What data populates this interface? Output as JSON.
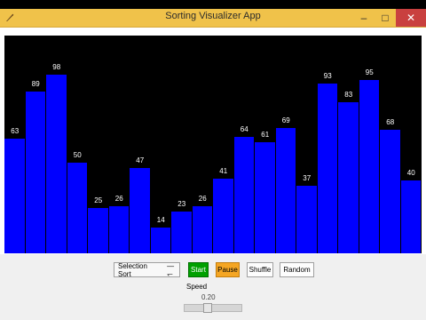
{
  "window": {
    "title": "Sorting Visualizer App"
  },
  "bars": [
    {
      "value": 63
    },
    {
      "value": 89
    },
    {
      "value": 98
    },
    {
      "value": 50
    },
    {
      "value": 25
    },
    {
      "value": 26
    },
    {
      "value": 47
    },
    {
      "value": 14
    },
    {
      "value": 23
    },
    {
      "value": 26
    },
    {
      "value": 41
    },
    {
      "value": 64
    },
    {
      "value": 61
    },
    {
      "value": 69
    },
    {
      "value": 37
    },
    {
      "value": 93
    },
    {
      "value": 83
    },
    {
      "value": 95
    },
    {
      "value": 68
    },
    {
      "value": 40
    }
  ],
  "colors": {
    "bar": "#0000ff",
    "canvas": "#000000",
    "titlebar": "#f0c24a",
    "start": "#00a000",
    "pause": "#f5a623"
  },
  "controls": {
    "algorithm_select": "Selection Sort",
    "start_label": "Start",
    "pause_label": "Pause",
    "shuffle_label": "Shuffle",
    "random_label": "Random",
    "speed_label": "Speed",
    "speed_value": "0.20"
  },
  "icons": {
    "app": "feather-icon",
    "minimize": "minimize-icon",
    "maximize": "maximize-icon",
    "close": "close-icon"
  }
}
